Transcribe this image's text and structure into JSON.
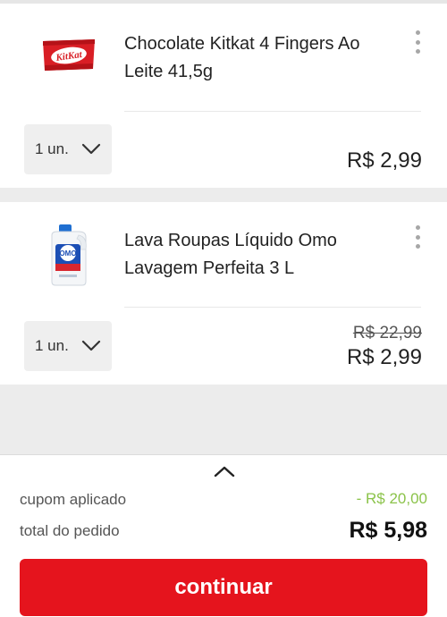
{
  "cart": {
    "items": [
      {
        "name": "Chocolate Kitkat 4 Fingers Ao Leite 41,5g",
        "image_icon": "kitkat-wrapper-icon",
        "image_text": "KitKat",
        "qty_label": "1 un.",
        "price": "R$ 2,99",
        "brand_color": "#e4262b"
      },
      {
        "name": "Lava Roupas Líquido Omo Lavagem Perfeita 3 L",
        "image_icon": "detergent-bottle-icon",
        "image_text": "OMO",
        "qty_label": "1 un.",
        "old_price": "R$ 22,99",
        "price": "R$ 2,99"
      }
    ]
  },
  "summary": {
    "coupon_label": "cupom aplicado",
    "coupon_value": "- R$ 20,00",
    "total_label": "total do pedido",
    "total_value": "R$ 5,98",
    "coupon_color": "#8bc34a"
  },
  "actions": {
    "continue_label": "continuar",
    "accent_color": "#e5141d"
  }
}
